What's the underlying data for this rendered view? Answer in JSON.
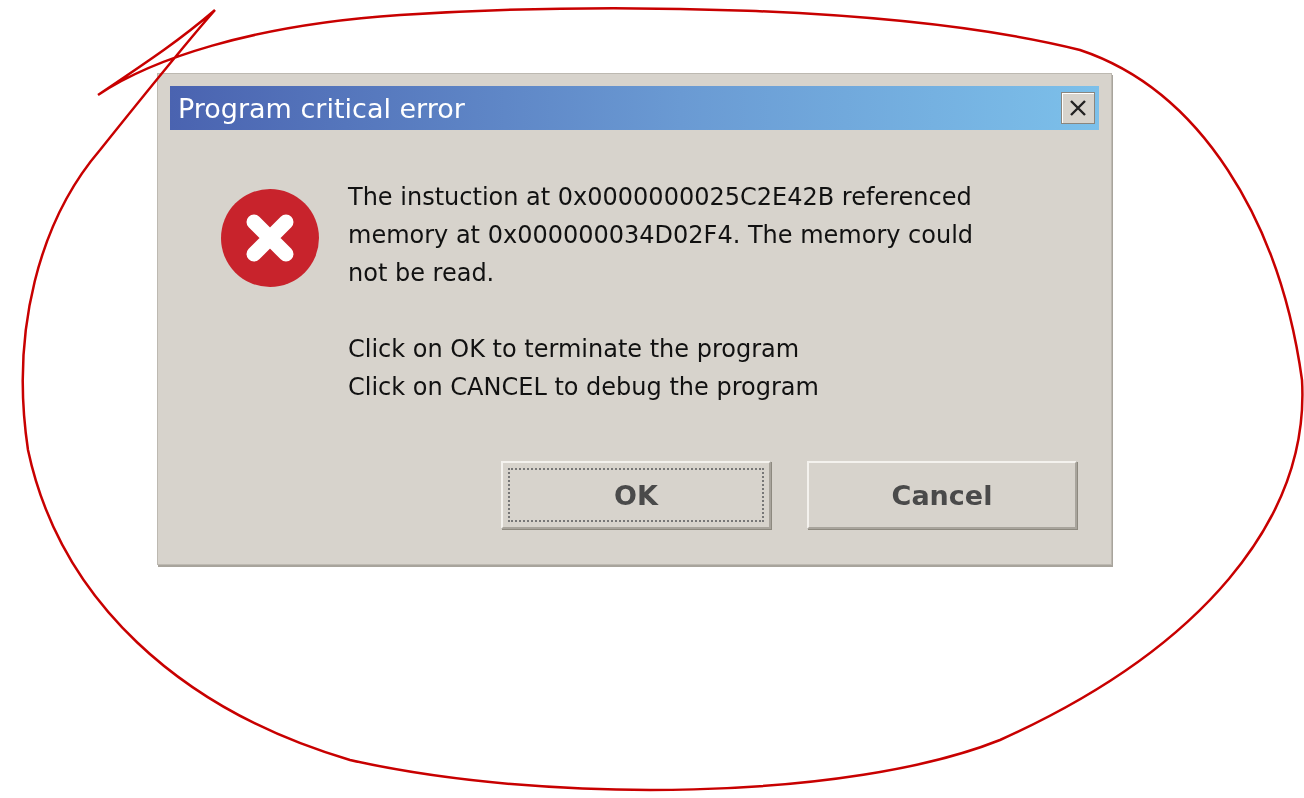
{
  "window": {
    "title": "Program critical error"
  },
  "dialog": {
    "message": "The instuction at 0x0000000025C2E42B referenced\nmemory at 0x000000034D02F4. The memory could\nnot be read.",
    "instructions": [
      "Click on OK to terminate the program",
      "Click on CANCEL to debug the program"
    ]
  },
  "buttons": [
    {
      "label": "OK",
      "focused": true
    },
    {
      "label": "Cancel",
      "focused": false
    }
  ]
}
